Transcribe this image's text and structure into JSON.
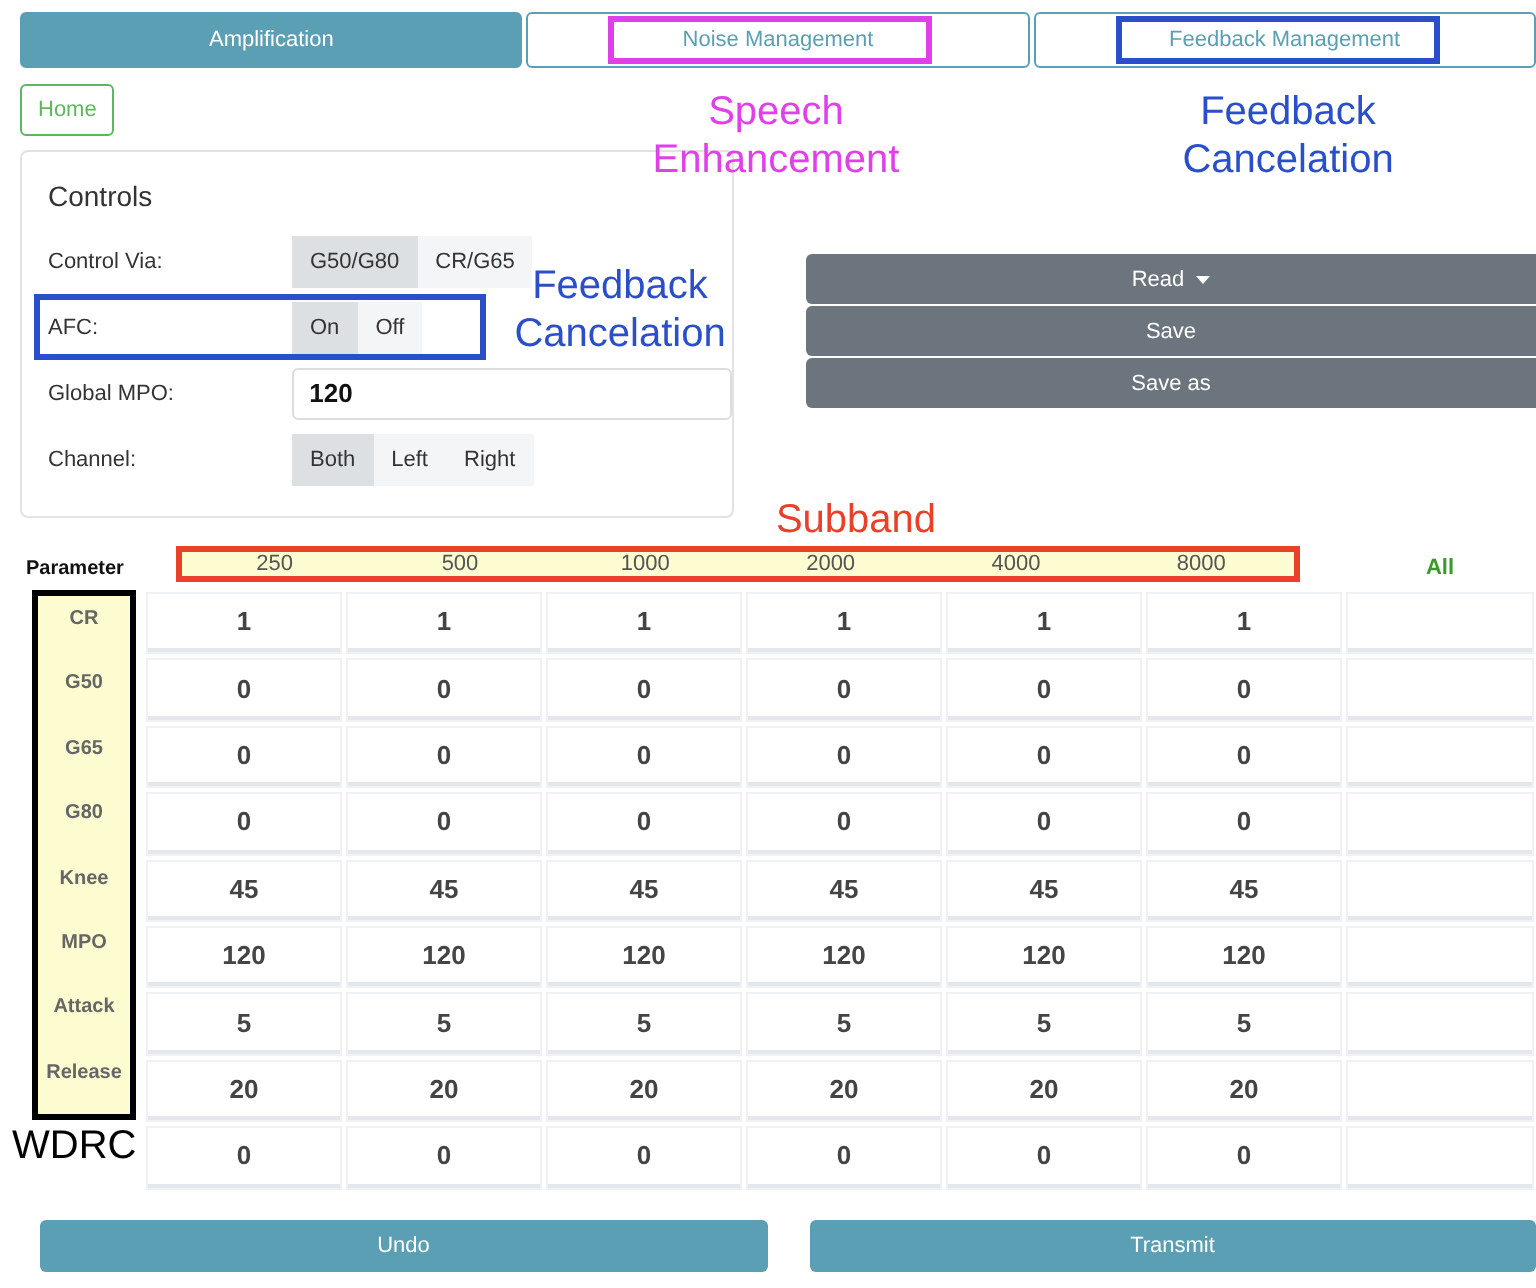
{
  "tabs": [
    {
      "label": "Amplification",
      "selected": true
    },
    {
      "label": "Noise Management",
      "selected": false,
      "highlight": {
        "color": "#e040e8"
      }
    },
    {
      "label": "Feedback Management",
      "selected": false,
      "highlight": {
        "color": "#2a4fc8"
      }
    }
  ],
  "home_button": "Home",
  "controls": {
    "title": "Controls",
    "rows": [
      {
        "label": "Control Via:",
        "kind": "toggle",
        "options": [
          {
            "label": "G50/G80",
            "selected": true
          },
          {
            "label": "CR/G65",
            "selected": false
          }
        ]
      },
      {
        "label": "AFC:",
        "kind": "toggle",
        "highlight": {
          "color": "#2a4fc8"
        },
        "options": [
          {
            "label": "On",
            "selected": true
          },
          {
            "label": "Off",
            "selected": false
          }
        ]
      },
      {
        "label": "Global MPO:",
        "kind": "input",
        "value": "120"
      },
      {
        "label": "Channel:",
        "kind": "toggle",
        "options": [
          {
            "label": "Both",
            "selected": true
          },
          {
            "label": "Left",
            "selected": false
          },
          {
            "label": "Right",
            "selected": false
          }
        ]
      }
    ]
  },
  "actions": [
    {
      "label": "Read",
      "kind": "dropdown"
    },
    {
      "label": "Save",
      "kind": "button"
    },
    {
      "label": "Save as",
      "kind": "button"
    }
  ],
  "annotations": [
    {
      "text": "Speech Enhancement",
      "color": "#e040e8"
    },
    {
      "text": "Feedback Cancelation",
      "color": "#2a4fc8"
    },
    {
      "text": "Feedback Cancelation",
      "color": "#2a4fc8"
    },
    {
      "text": "Subband",
      "color": "#e8402a"
    }
  ],
  "table": {
    "parameter_label": "Parameter",
    "subband_highlight": {
      "color": "#e8402a"
    },
    "parameter_highlight": {
      "color": "#000000"
    },
    "columns": [
      "250",
      "500",
      "1000",
      "2000",
      "4000",
      "8000"
    ],
    "all_label": "All",
    "rows": [
      {
        "parameter": "CR",
        "values": [
          "1",
          "1",
          "1",
          "1",
          "1",
          "1"
        ]
      },
      {
        "parameter": "G50",
        "values": [
          "0",
          "0",
          "0",
          "0",
          "0",
          "0"
        ]
      },
      {
        "parameter": "G65",
        "values": [
          "0",
          "0",
          "0",
          "0",
          "0",
          "0"
        ]
      },
      {
        "parameter": "G80",
        "values": [
          "0",
          "0",
          "0",
          "0",
          "0",
          "0"
        ]
      },
      {
        "parameter": "Knee",
        "values": [
          "45",
          "45",
          "45",
          "45",
          "45",
          "45"
        ]
      },
      {
        "parameter": "MPO",
        "values": [
          "120",
          "120",
          "120",
          "120",
          "120",
          "120"
        ]
      },
      {
        "parameter": "Attack",
        "values": [
          "5",
          "5",
          "5",
          "5",
          "5",
          "5"
        ]
      },
      {
        "parameter": "Release",
        "values": [
          "20",
          "20",
          "20",
          "20",
          "20",
          "20"
        ]
      },
      {
        "values": [
          "0",
          "0",
          "0",
          "0",
          "0",
          "0"
        ]
      }
    ],
    "group_label": "WDRC"
  },
  "bottom_buttons": [
    "Undo",
    "Transmit"
  ]
}
